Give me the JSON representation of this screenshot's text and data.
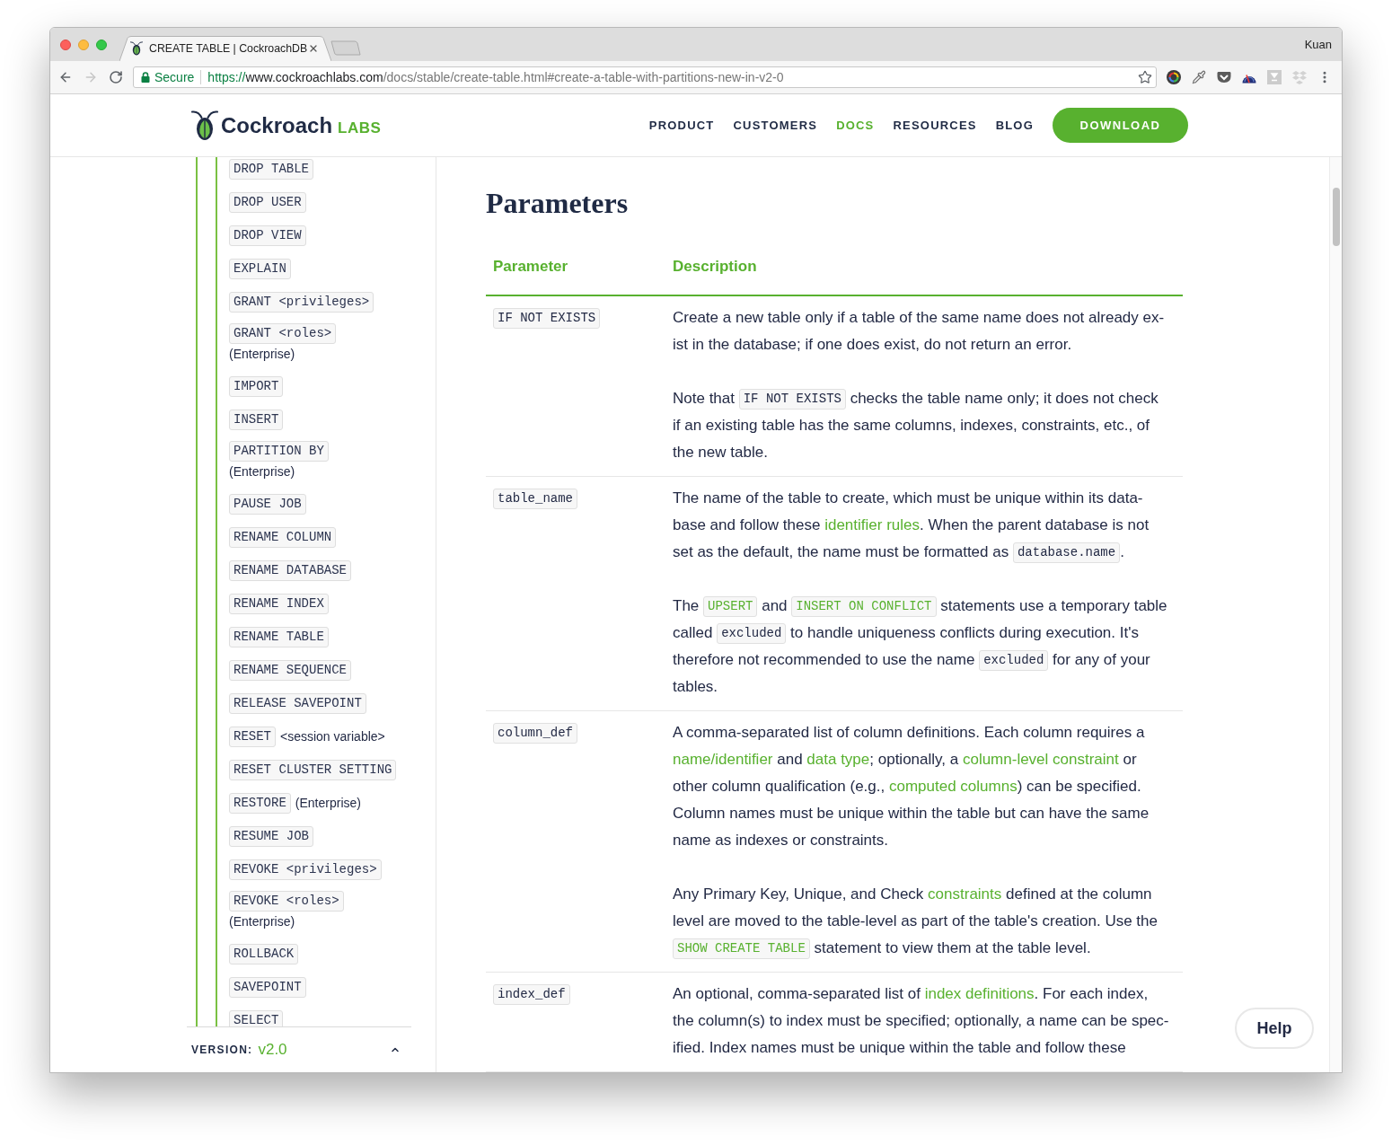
{
  "browser": {
    "tabs": [
      {
        "title": "CREATE TABLE | CockroachDB",
        "selected": true
      }
    ],
    "profile": "Kuan",
    "toolbar": {
      "back": {
        "disabled": false
      },
      "forward": {
        "disabled": true
      }
    },
    "address": {
      "security": "Secure",
      "scheme": "https://",
      "host": "www.cockroachlabs.com",
      "path": "/docs/stable/create-table.html#create-a-table-with-partitions-new-in-v2-0"
    }
  },
  "header": {
    "logo": {
      "name": "Cockroach",
      "suffix": "LABS"
    },
    "nav": [
      {
        "label": "PRODUCT",
        "selected": false
      },
      {
        "label": "CUSTOMERS",
        "selected": false
      },
      {
        "label": "DOCS",
        "selected": true
      },
      {
        "label": "RESOURCES",
        "selected": false
      },
      {
        "label": "BLOG",
        "selected": false
      }
    ],
    "cta": "DOWNLOAD"
  },
  "sidebar": {
    "items": [
      {
        "kind": "plain",
        "label": "DROP TABLE"
      },
      {
        "kind": "plain",
        "label": "DROP USER"
      },
      {
        "kind": "plain",
        "label": "DROP VIEW"
      },
      {
        "kind": "plain",
        "label": "EXPLAIN"
      },
      {
        "kind": "plain",
        "label": "GRANT <privileges>"
      },
      {
        "kind": "stacked",
        "label": "GRANT <roles>",
        "note": "(Enterprise)"
      },
      {
        "kind": "plain",
        "label": "IMPORT"
      },
      {
        "kind": "plain",
        "label": "INSERT"
      },
      {
        "kind": "stacked",
        "label": "PARTITION BY",
        "note": "(Enterprise)"
      },
      {
        "kind": "plain",
        "label": "PAUSE JOB"
      },
      {
        "kind": "plain",
        "label": "RENAME COLUMN"
      },
      {
        "kind": "plain",
        "label": "RENAME DATABASE"
      },
      {
        "kind": "plain",
        "label": "RENAME INDEX"
      },
      {
        "kind": "plain",
        "label": "RENAME TABLE"
      },
      {
        "kind": "plain",
        "label": "RENAME SEQUENCE"
      },
      {
        "kind": "plain",
        "label": "RELEASE SAVEPOINT"
      },
      {
        "kind": "inline",
        "label": "RESET",
        "note": "<session variable>"
      },
      {
        "kind": "plain",
        "label": "RESET CLUSTER SETTING"
      },
      {
        "kind": "inline",
        "label": "RESTORE",
        "note": "(Enterprise)"
      },
      {
        "kind": "plain",
        "label": "RESUME JOB"
      },
      {
        "kind": "plain",
        "label": "REVOKE <privileges>"
      },
      {
        "kind": "stacked",
        "label": "REVOKE <roles>",
        "note": "(Enterprise)"
      },
      {
        "kind": "plain",
        "label": "ROLLBACK"
      },
      {
        "kind": "plain",
        "label": "SAVEPOINT"
      },
      {
        "kind": "plain",
        "label": "SELECT"
      }
    ],
    "version": {
      "label": "VERSION:",
      "value": "v2.0"
    }
  },
  "main": {
    "heading": "Parameters",
    "table": {
      "columns": [
        "Parameter",
        "Description"
      ],
      "rows": [
        {
          "parameter": "IF NOT EXISTS",
          "description": [
            {
              "lines": [
                [
                  {
                    "kind": "text",
                    "text": "Create a new table only if a table of the same name does not already ex-"
                  }
                ],
                [
                  {
                    "kind": "text",
                    "text": "ist in the database; if one does exist, do not return an error."
                  }
                ]
              ]
            },
            {
              "lines": [
                [
                  {
                    "kind": "text",
                    "text": "Note that "
                  },
                  {
                    "kind": "code",
                    "text": "IF NOT EXISTS"
                  },
                  {
                    "kind": "text",
                    "text": " checks the table name only; it does not check"
                  }
                ],
                [
                  {
                    "kind": "text",
                    "text": "if an existing table has the same columns, indexes, constraints, etc., of"
                  }
                ],
                [
                  {
                    "kind": "text",
                    "text": "the new table."
                  }
                ]
              ]
            }
          ]
        },
        {
          "parameter": "table_name",
          "description": [
            {
              "lines": [
                [
                  {
                    "kind": "text",
                    "text": "The name of the table to create, which must be unique within its data-"
                  }
                ],
                [
                  {
                    "kind": "text",
                    "text": "base and follow these "
                  },
                  {
                    "kind": "link",
                    "text": "identifier rules"
                  },
                  {
                    "kind": "text",
                    "text": ". When the parent database is not"
                  }
                ],
                [
                  {
                    "kind": "text",
                    "text": "set as the default, the name must be formatted as "
                  },
                  {
                    "kind": "code",
                    "text": "database.name"
                  },
                  {
                    "kind": "text",
                    "text": "."
                  }
                ]
              ]
            },
            {
              "lines": [
                [
                  {
                    "kind": "text",
                    "text": "The "
                  },
                  {
                    "kind": "code_link",
                    "text": "UPSERT"
                  },
                  {
                    "kind": "text",
                    "text": " and "
                  },
                  {
                    "kind": "code_link",
                    "text": "INSERT ON CONFLICT"
                  },
                  {
                    "kind": "text",
                    "text": " statements use a temporary table"
                  }
                ],
                [
                  {
                    "kind": "text",
                    "text": "called "
                  },
                  {
                    "kind": "code",
                    "text": "excluded"
                  },
                  {
                    "kind": "text",
                    "text": " to handle uniqueness conflicts during execution. It's"
                  }
                ],
                [
                  {
                    "kind": "text",
                    "text": "therefore not recommended to use the name "
                  },
                  {
                    "kind": "code",
                    "text": "excluded"
                  },
                  {
                    "kind": "text",
                    "text": " for any of your"
                  }
                ],
                [
                  {
                    "kind": "text",
                    "text": "tables."
                  }
                ]
              ]
            }
          ]
        },
        {
          "parameter": "column_def",
          "description": [
            {
              "lines": [
                [
                  {
                    "kind": "text",
                    "text": "A comma-separated list of column definitions. Each column requires a"
                  }
                ],
                [
                  {
                    "kind": "link",
                    "text": "name/identifier"
                  },
                  {
                    "kind": "text",
                    "text": " and "
                  },
                  {
                    "kind": "link",
                    "text": "data type"
                  },
                  {
                    "kind": "text",
                    "text": "; optionally, a "
                  },
                  {
                    "kind": "link",
                    "text": "column-level constraint"
                  },
                  {
                    "kind": "text",
                    "text": " or"
                  }
                ],
                [
                  {
                    "kind": "text",
                    "text": "other column qualification (e.g., "
                  },
                  {
                    "kind": "link",
                    "text": "computed columns"
                  },
                  {
                    "kind": "text",
                    "text": ") can be specified."
                  }
                ],
                [
                  {
                    "kind": "text",
                    "text": "Column names must be unique within the table but can have the same"
                  }
                ],
                [
                  {
                    "kind": "text",
                    "text": "name as indexes or constraints."
                  }
                ]
              ]
            },
            {
              "lines": [
                [
                  {
                    "kind": "text",
                    "text": "Any Primary Key, Unique, and Check "
                  },
                  {
                    "kind": "link",
                    "text": "constraints"
                  },
                  {
                    "kind": "text",
                    "text": " defined at the column"
                  }
                ],
                [
                  {
                    "kind": "text",
                    "text": "level are moved to the table-level as part of the table's creation. Use the"
                  }
                ],
                [
                  {
                    "kind": "code_link",
                    "text": "SHOW CREATE TABLE"
                  },
                  {
                    "kind": "text",
                    "text": " statement to view them at the table level."
                  }
                ]
              ]
            }
          ]
        },
        {
          "parameter": "index_def",
          "description": [
            {
              "lines": [
                [
                  {
                    "kind": "text",
                    "text": "An optional, comma-separated list of "
                  },
                  {
                    "kind": "link",
                    "text": "index definitions"
                  },
                  {
                    "kind": "text",
                    "text": ". For each index,"
                  }
                ],
                [
                  {
                    "kind": "text",
                    "text": "the column(s) to index must be specified; optionally, a name can be spec-"
                  }
                ],
                [
                  {
                    "kind": "text",
                    "text": "ified. Index names must be unique within the table and follow these"
                  }
                ]
              ]
            }
          ]
        }
      ]
    }
  },
  "help_button": "Help"
}
